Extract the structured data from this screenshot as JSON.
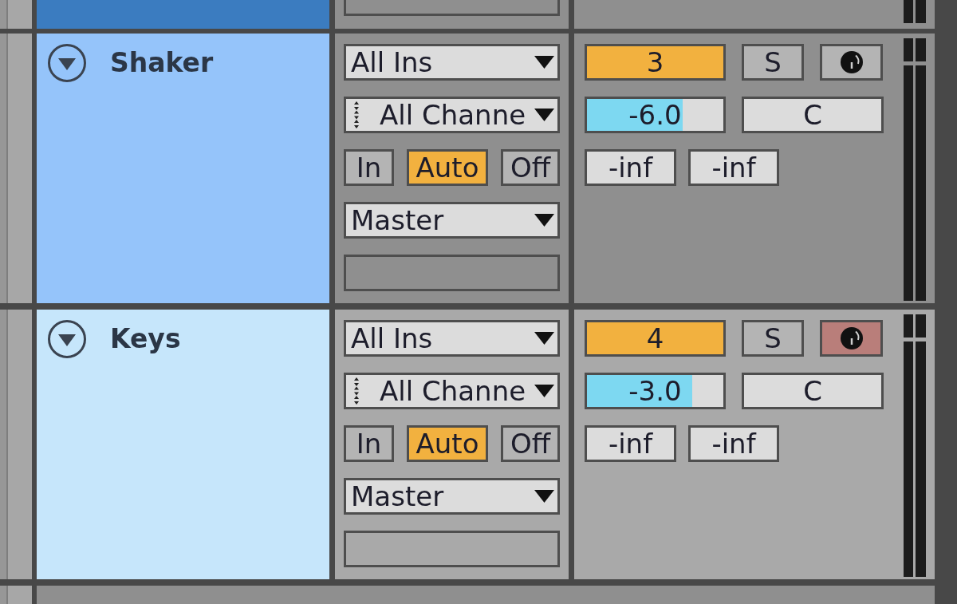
{
  "track_above": {
    "color": "#3b7cc0"
  },
  "tracks": [
    {
      "name": "Shaker",
      "color": "#95c4fa",
      "selected": false,
      "expanded": true,
      "input_type": "All Ins",
      "input_channel": "All Channe",
      "monitor": [
        {
          "label": "In",
          "selected": false
        },
        {
          "label": "Auto",
          "selected": true
        },
        {
          "label": "Off",
          "selected": false
        }
      ],
      "output_type": "Master",
      "activator": {
        "label": "3",
        "on": true
      },
      "solo": {
        "label": "S",
        "on": false
      },
      "arm": {
        "on": false
      },
      "volume": {
        "reading": "-6.0",
        "level": 0.7
      },
      "pan": "C",
      "peaks": [
        "-inf",
        "-inf"
      ]
    },
    {
      "name": "Keys",
      "color": "#c6e6fb",
      "selected": true,
      "expanded": true,
      "input_type": "All Ins",
      "input_channel": "All Channe",
      "monitor": [
        {
          "label": "In",
          "selected": false
        },
        {
          "label": "Auto",
          "selected": true
        },
        {
          "label": "Off",
          "selected": false
        }
      ],
      "output_type": "Master",
      "activator": {
        "label": "4",
        "on": true
      },
      "solo": {
        "label": "S",
        "on": false
      },
      "arm": {
        "on": true
      },
      "volume": {
        "reading": "-3.0",
        "level": 0.77
      },
      "pan": "C",
      "peaks": [
        "-inf",
        "-inf"
      ]
    }
  ]
}
